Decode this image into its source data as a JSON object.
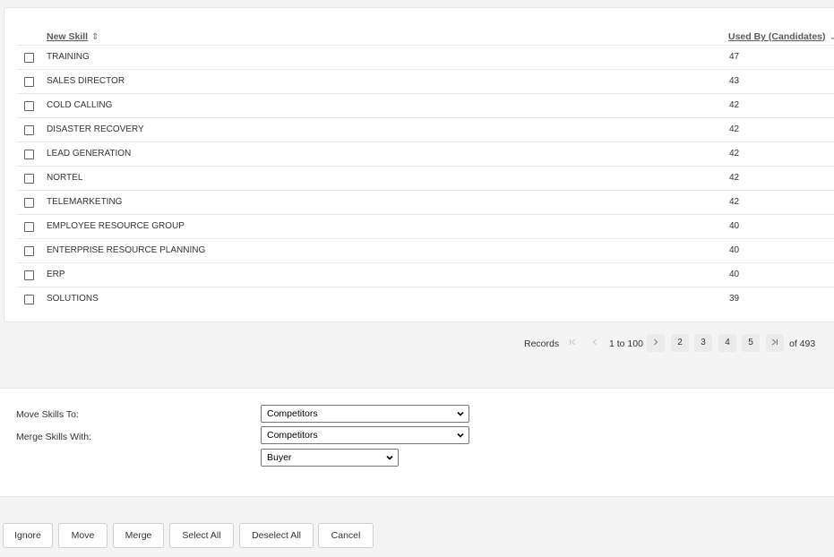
{
  "table": {
    "columns": {
      "skill": "New Skill",
      "skill_sort": "⇕",
      "used_by": "Used By (Candidates)",
      "used_by_sort": "⌄"
    },
    "rows": [
      {
        "skill": "TRAINING",
        "count": "47"
      },
      {
        "skill": "SALES DIRECTOR",
        "count": "43"
      },
      {
        "skill": "COLD CALLING",
        "count": "42"
      },
      {
        "skill": "DISASTER RECOVERY",
        "count": "42"
      },
      {
        "skill": "LEAD GENERATION",
        "count": "42"
      },
      {
        "skill": "NORTEL",
        "count": "42"
      },
      {
        "skill": "TELEMARKETING",
        "count": "42"
      },
      {
        "skill": "EMPLOYEE RESOURCE GROUP",
        "count": "40"
      },
      {
        "skill": "ENTERPRISE RESOURCE PLANNING",
        "count": "40"
      },
      {
        "skill": "ERP",
        "count": "40"
      },
      {
        "skill": "SOLUTIONS",
        "count": "39"
      }
    ]
  },
  "pagination": {
    "records_label": "Records",
    "first_icon": "first-page-icon",
    "prev_icon": "prev-page-icon",
    "range": "1 to 100",
    "next_icon": "next-page-icon",
    "pages": [
      "2",
      "3",
      "4",
      "5"
    ],
    "last_icon": "last-page-icon",
    "total": "of 493"
  },
  "form": {
    "move_label": "Move Skills To:",
    "move_value": "Competitors",
    "merge_label": "Merge Skills With:",
    "merge_value": "Competitors",
    "merge_sub_value": "Buyer"
  },
  "actions": {
    "ignore": "Ignore",
    "move": "Move",
    "merge": "Merge",
    "select_all": "Select All",
    "deselect_all": "Deselect All",
    "cancel": "Cancel"
  }
}
